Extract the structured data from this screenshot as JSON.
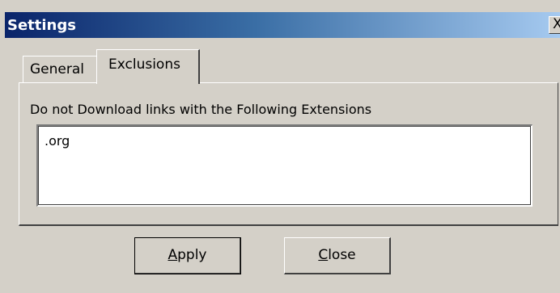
{
  "window": {
    "title": "Settings",
    "close_glyph": "X"
  },
  "tabs": [
    {
      "label": "General",
      "selected": false
    },
    {
      "label": "Exclusions",
      "selected": true
    }
  ],
  "exclusions": {
    "label": "Do not Download links with the Following Extensions",
    "value": ".org"
  },
  "buttons": {
    "apply": {
      "mnemonic": "A",
      "rest": "pply"
    },
    "close": {
      "mnemonic": "C",
      "rest": "lose"
    }
  },
  "colors": {
    "face": "#d4d0c8",
    "titlebar_start": "#0a246a",
    "titlebar_end": "#a6caf0"
  }
}
